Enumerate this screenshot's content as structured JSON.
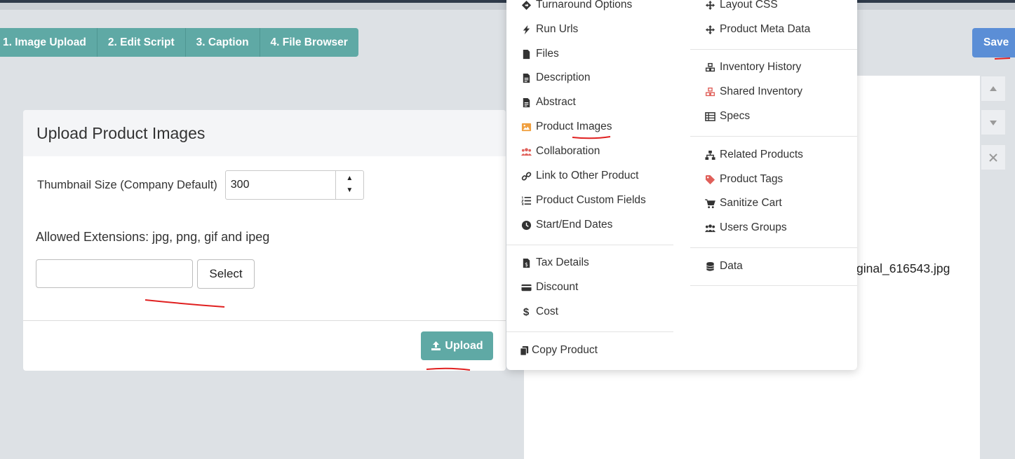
{
  "tabs": [
    "1. Image Upload",
    "2. Edit Script",
    "3. Caption",
    "4. File Browser"
  ],
  "save_label": "Save",
  "card": {
    "title": "Upload Product Images",
    "thumb_label": "Thumbnail Size (Company Default)",
    "thumb_value": "300",
    "allowed": "Allowed Extensions: jpg, png, gif and ipeg",
    "select_label": "Select",
    "upload_label": "Upload"
  },
  "filename": "ginal_616543.jpg",
  "menu": {
    "left": [
      {
        "label": "Turnaround Options",
        "icon": "diamond-directions-icon"
      },
      {
        "label": "Run Urls",
        "icon": "bolt-icon"
      },
      {
        "label": "Files",
        "icon": "file-icon"
      },
      {
        "label": "Description",
        "icon": "file-text-icon"
      },
      {
        "label": "Abstract",
        "icon": "file-text-icon"
      },
      {
        "label": "Product Images",
        "icon": "image-icon"
      },
      {
        "label": "Collaboration",
        "icon": "users-icon"
      },
      {
        "label": "Link to Other Product",
        "icon": "link-icon"
      },
      {
        "label": "Product Custom Fields",
        "icon": "list-ol-icon"
      },
      {
        "label": "Start/End Dates",
        "icon": "clock-icon"
      },
      {
        "label": "Tax Details",
        "icon": "file-invoice-dollar-icon"
      },
      {
        "label": "Discount",
        "icon": "credit-card-icon"
      },
      {
        "label": "Cost",
        "icon": "dollar-icon"
      },
      {
        "label": "Copy Product",
        "icon": "copy-icon"
      }
    ],
    "right": [
      {
        "label": "Layout CSS",
        "icon": "arrows-move-icon"
      },
      {
        "label": "Product Meta Data",
        "icon": "arrows-move-icon"
      },
      {
        "label": "Inventory History",
        "icon": "cubes-icon"
      },
      {
        "label": "Shared Inventory",
        "icon": "cubes-icon"
      },
      {
        "label": "Specs",
        "icon": "table-icon"
      },
      {
        "label": "Related Products",
        "icon": "sitemap-icon"
      },
      {
        "label": "Product Tags",
        "icon": "tag-icon"
      },
      {
        "label": "Sanitize Cart",
        "icon": "cart-icon"
      },
      {
        "label": "Users Groups",
        "icon": "users-icon"
      },
      {
        "label": "Data",
        "icon": "database-icon"
      }
    ]
  },
  "colors": {
    "teal": "#5fa9a5",
    "save_blue": "#5b8ed6",
    "icon_red": "#e0605a",
    "icon_orange": "#f0a040",
    "annotation_red": "#e02020"
  }
}
